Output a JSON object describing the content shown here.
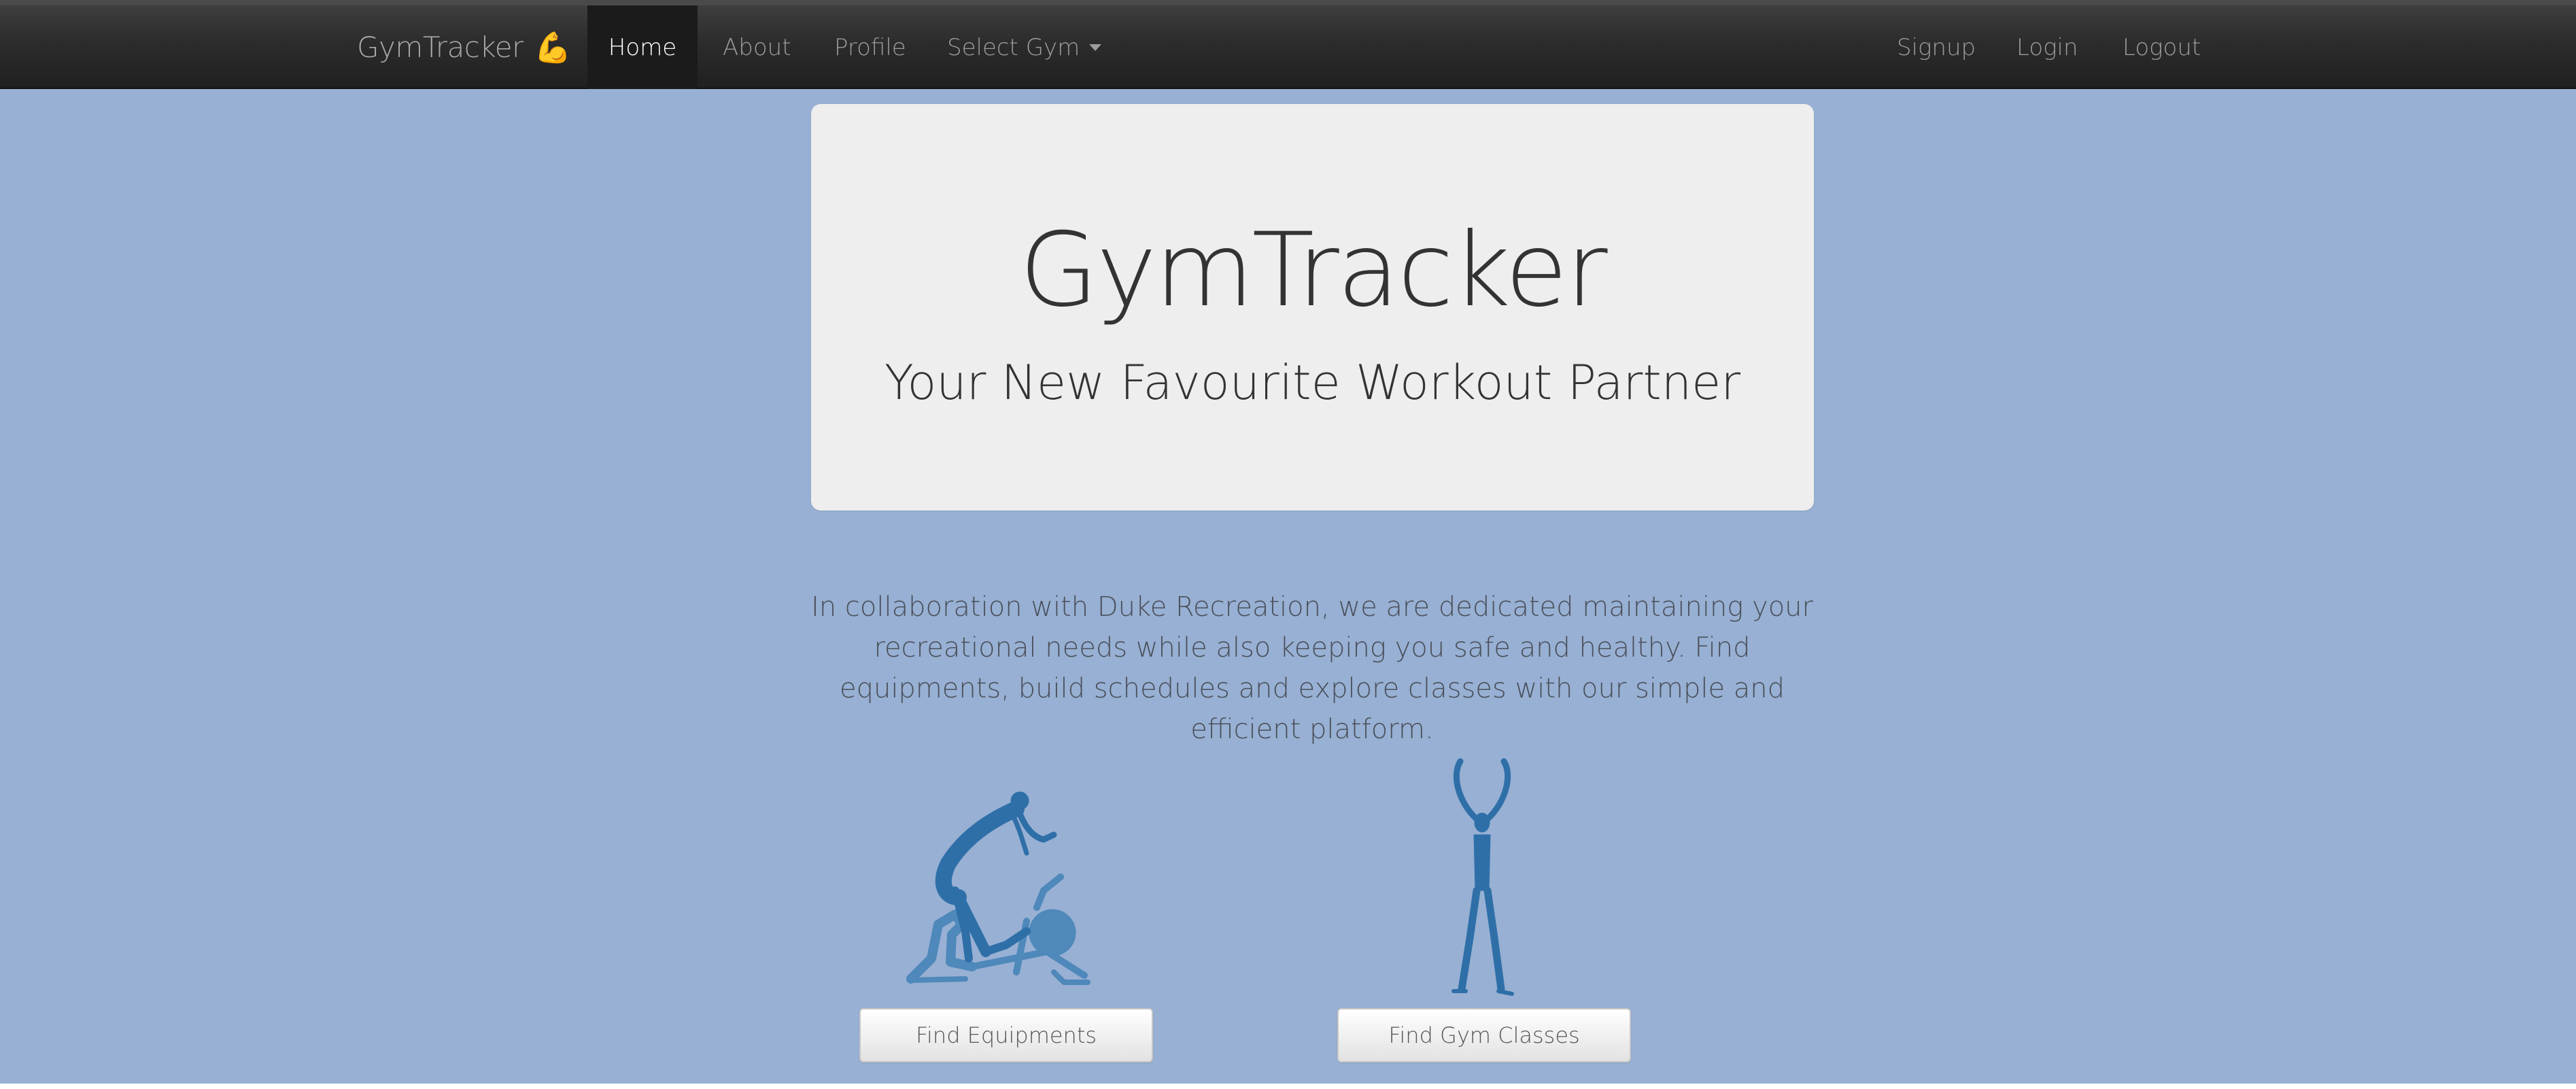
{
  "navbar": {
    "brand": "GymTracker",
    "brand_emoji": "💪",
    "items": [
      {
        "label": "Home",
        "active": true
      },
      {
        "label": "About"
      },
      {
        "label": "Profile"
      },
      {
        "label": "Select Gym",
        "dropdown": true
      }
    ],
    "right_items": [
      {
        "label": "Signup"
      },
      {
        "label": "Login"
      },
      {
        "label": "Logout"
      }
    ]
  },
  "jumbotron": {
    "title": "GymTracker",
    "subtitle": "Your New Favourite Workout Partner"
  },
  "description": "In collaboration with Duke Recreation, we are dedicated maintaining your recreational needs while also keeping you safe and healthy. Find equipments, build schedules and explore classes with our simple and efficient platform.",
  "features": [
    {
      "icon": "exercise-bike-figure-icon",
      "button_label": "Find Equipments"
    },
    {
      "icon": "stretching-figure-icon",
      "button_label": "Find Gym Classes"
    }
  ],
  "colors": {
    "page_background": "#97b0d3",
    "navbar": "#2c2c2c",
    "jumbotron": "#eeeeee",
    "illustration_blue": "#2f6fa8",
    "illustration_light_blue": "#4f88bb"
  }
}
